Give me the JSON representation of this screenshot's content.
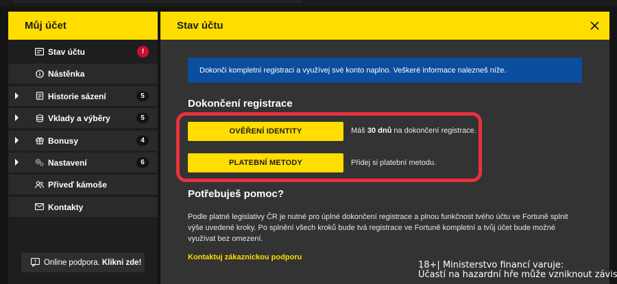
{
  "sidebar": {
    "title": "Můj účet",
    "items": [
      {
        "label": "Stav účtu",
        "badge": "!",
        "icon": "account-status-icon",
        "expandable": false,
        "active": true
      },
      {
        "label": "Nástěnka",
        "badge": "",
        "icon": "info-icon",
        "expandable": false,
        "active": false
      },
      {
        "label": "Historie sázení",
        "badge": "5",
        "icon": "history-icon",
        "expandable": true,
        "active": false
      },
      {
        "label": "Vklady a výběry",
        "badge": "5",
        "icon": "coins-icon",
        "expandable": true,
        "active": false
      },
      {
        "label": "Bonusy",
        "badge": "4",
        "icon": "gift-icon",
        "expandable": true,
        "active": false
      },
      {
        "label": "Nastavení",
        "badge": "6",
        "icon": "settings-icon",
        "expandable": true,
        "active": false
      },
      {
        "label": "Přiveď kámoše",
        "badge": "",
        "icon": "users-icon",
        "expandable": false,
        "active": false
      },
      {
        "label": "Kontakty",
        "badge": "",
        "icon": "mail-icon",
        "expandable": false,
        "active": false
      }
    ],
    "support": {
      "text": "Online podpora.",
      "link": "Klikni zde!"
    }
  },
  "panel": {
    "title": "Stav účtu",
    "banner": "Dokonči kompletní registraci a využívej své konto naplno. Veškeré informace nalezneš níže.",
    "registration": {
      "title": "Dokončení registrace",
      "identity_button": "OVĚŘENÍ IDENTITY",
      "identity_note_pre": "Máš",
      "identity_note_bold": "30 dnů",
      "identity_note_post": "na dokončení registrace.",
      "payment_button": "PLATEBNÍ METODY",
      "payment_note": "Přidej si platební metodu."
    },
    "help": {
      "title": "Potřebuješ pomoc?",
      "text": "Podle platné legislativy ČR je nutné pro úplné dokončení registrace a plnou funkčnost tvého účtu ve Fortuně splnit výše uvedené kroky. Po splnění všech kroků bude tvá registrace ve Fortuně kompletní a tvůj účet bude možné využívat bez omezení.",
      "contact_link": "Kontaktuj zákaznickou podporu"
    }
  },
  "warning": {
    "line1": "18+| Ministerstvo financí varuje:",
    "line2": "Účastí na hazardní hře může vzniknout závislost."
  },
  "colors": {
    "brand_yellow": "#ffdd00",
    "banner_blue": "#0b4d9e",
    "highlight_red": "#e8323c",
    "alert_red": "#c8102e"
  }
}
